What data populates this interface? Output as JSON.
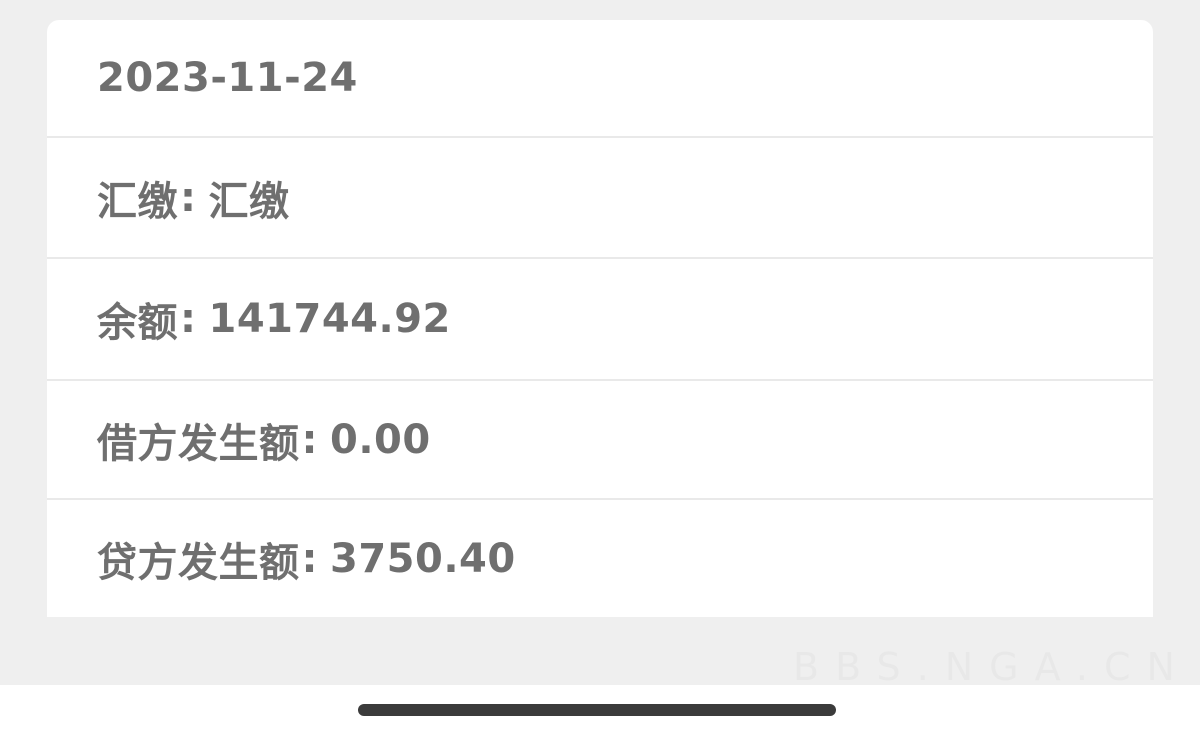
{
  "record": {
    "date": "2023-11-24",
    "type_label": "汇缴",
    "type_value": "汇缴",
    "balance_label": "余额",
    "balance_value": "141744.92",
    "debit_label": "借方发生额",
    "debit_value": "0.00",
    "credit_label": "贷方发生额",
    "credit_value": "3750.40",
    "separator": ":"
  },
  "watermark": {
    "text": "BBS.NGA.CN"
  }
}
